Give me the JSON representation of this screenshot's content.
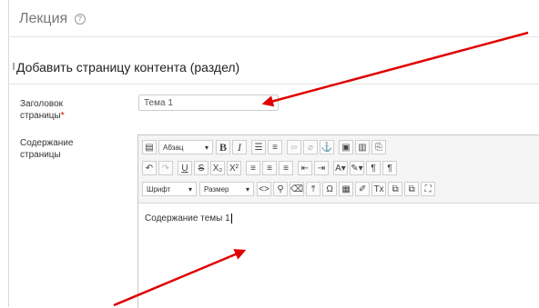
{
  "header": {
    "title": "Лекция",
    "help_icon": "help-circle-icon"
  },
  "section": {
    "title": "Добавить страницу контента (раздел)"
  },
  "fields": {
    "title_label": "Заголовок страницы",
    "required_mark": "*",
    "title_value": "Тема 1",
    "content_label": "Содержание страницы"
  },
  "editor": {
    "paragraph_select": "Абзац",
    "font_select": "Шрифт",
    "size_select": "Размер",
    "content_text": "Содержание темы 1"
  },
  "annotations": {
    "arrow_color": "#e00000"
  }
}
